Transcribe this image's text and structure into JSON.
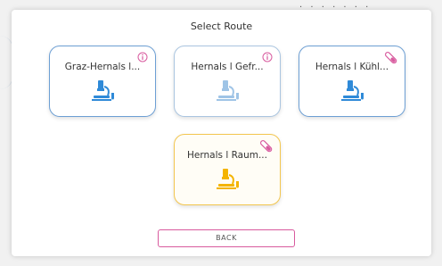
{
  "header_dots": ". . . . . . .",
  "dialog": {
    "title": "Select Route",
    "routes": [
      {
        "label": "Graz-Hernals l...",
        "icon": "microscope-icon",
        "badge": "info-icon"
      },
      {
        "label": "Hernals l Gefr...",
        "icon": "microscope-icon",
        "badge": "info-icon"
      },
      {
        "label": "Hernals l Kühl...",
        "icon": "microscope-icon",
        "badge": "test-tube-icon"
      },
      {
        "label": "Hernals l Raum...",
        "icon": "microscope-icon",
        "badge": "test-tube-icon"
      }
    ],
    "back_label": "BACK"
  },
  "colors": {
    "blue": "#2f8ad8",
    "pale_blue": "#9fc4e6",
    "yellow": "#f4b400",
    "pink": "#d85a9e"
  }
}
